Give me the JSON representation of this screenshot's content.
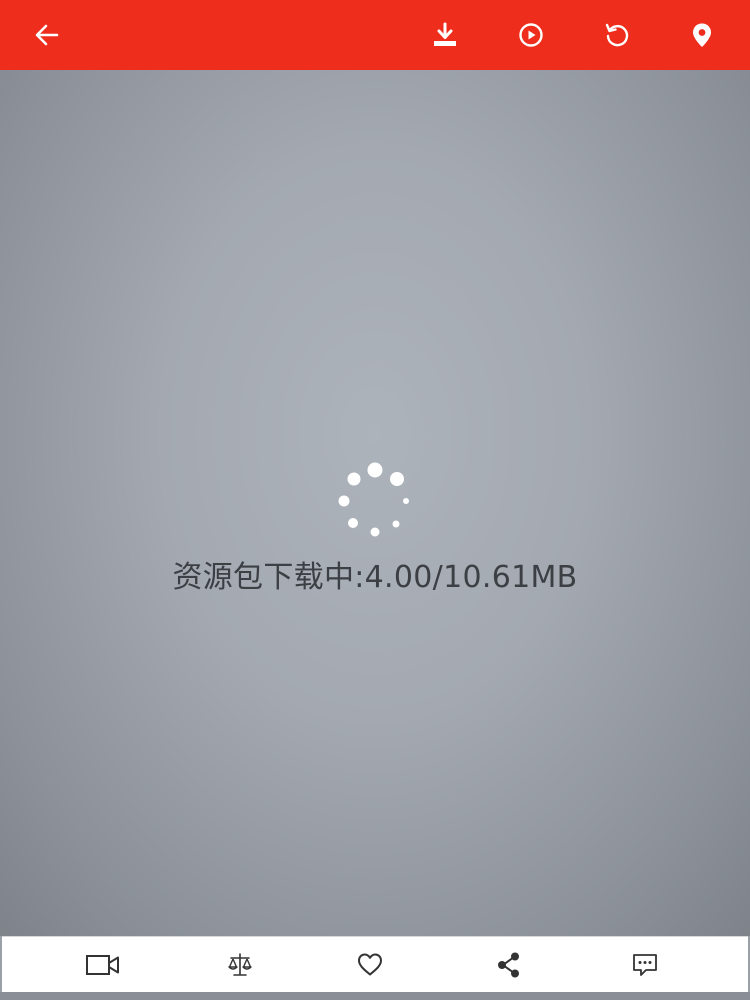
{
  "colors": {
    "topbar": "#ee2d1d",
    "icon_light": "#ffffff",
    "icon_dark": "#333333",
    "text": "#3c3f44"
  },
  "topbar": {
    "left_icons": [
      "back-arrow-icon"
    ],
    "right_icons": [
      "download-icon",
      "play-icon",
      "refresh-icon",
      "location-pin-icon"
    ]
  },
  "loading": {
    "label": "资源包下载中:",
    "downloaded": "4.00",
    "separator": "/",
    "total": "10.61MB"
  },
  "bottombar": {
    "icons": [
      "video-camera-icon",
      "balance-scale-icon",
      "heart-icon",
      "share-icon",
      "comment-icon"
    ]
  }
}
